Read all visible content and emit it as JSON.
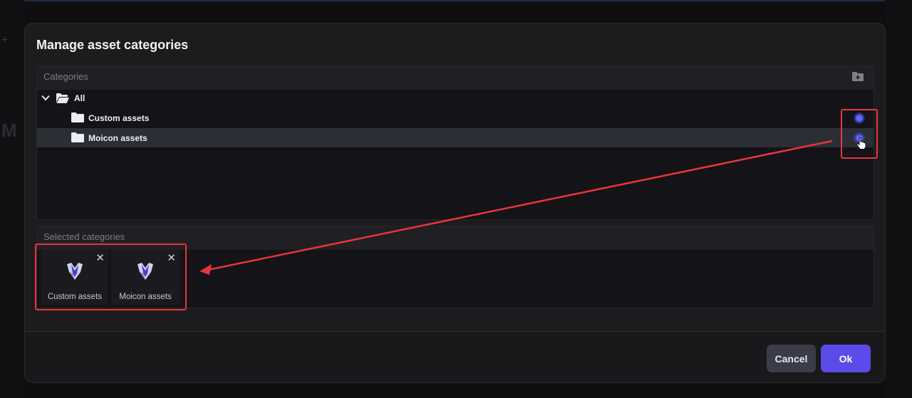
{
  "dialog": {
    "title": "Manage asset categories",
    "cancel_label": "Cancel",
    "ok_label": "Ok"
  },
  "categories_panel": {
    "header": "Categories",
    "add_icon": "add-folder-icon",
    "tree": [
      {
        "label": "All",
        "icon": "folder-open-icon",
        "expanded": true
      },
      {
        "label": "Custom assets",
        "icon": "folder-icon",
        "selected": true
      },
      {
        "label": "Moicon assets",
        "icon": "folder-icon",
        "selected": true,
        "hovered": true
      }
    ]
  },
  "selected_panel": {
    "header": "Selected categories",
    "items": [
      {
        "label": "Custom assets",
        "close": "✕",
        "icon": "moicon-logo-icon"
      },
      {
        "label": "Moicon assets",
        "close": "✕",
        "icon": "moicon-logo-icon"
      }
    ]
  },
  "colors": {
    "accent": "#5b4bea",
    "annotation": "#e8353b",
    "dialog_bg": "#1c1c1e"
  }
}
